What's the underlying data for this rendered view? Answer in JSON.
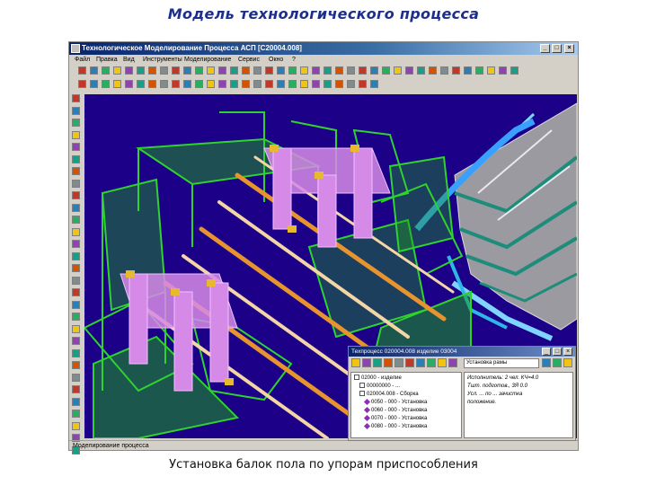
{
  "slide": {
    "title": "Модель технологического процесса",
    "caption": "Установка балок пола по упорам приспособления"
  },
  "main_window": {
    "title": "Технологическое Моделирование Процесса АСП  [С20004.008]",
    "menu": [
      "Файл",
      "Правка",
      "Вид",
      "Инструменты",
      "Моделирование",
      "Сервис",
      "Окно",
      "?"
    ],
    "status": "Моделирование процесса"
  },
  "sub_window": {
    "title": "Техпроцесс 020004.008 изделие 03004",
    "dropdown": "Установка рамы",
    "tree": [
      "02000 - изделие",
      "00000000 - ...",
      "020004.008 - Сборка",
      "0050 - 000 - Установка",
      "0060 - 000 - Установка",
      "0070 - 000 - Установка",
      "0080 - 000 - Установка"
    ],
    "props": [
      "Исполнитель: 2 чел.  КЧ=4.0",
      "Тшт. подготов., 3Я  0.0",
      "Усл.  ... по  ... зачистка",
      "положение."
    ]
  },
  "icons": {
    "titlebar": [
      "app-icon",
      "minimize-icon",
      "maximize-icon",
      "close-icon"
    ]
  },
  "colors": {
    "viewport_bg": "#1c0088",
    "structure": "#2fd22f",
    "fixture": "#d68ae8",
    "beam": "#e8942e",
    "hull": "#9a9aa0",
    "hull_frame": "#1e8c7a"
  }
}
